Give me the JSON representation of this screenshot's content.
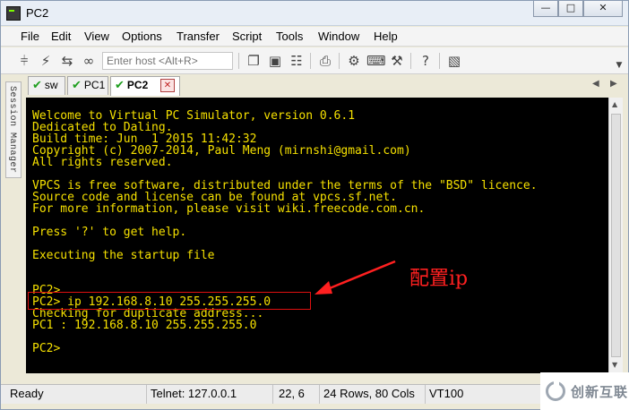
{
  "window": {
    "title": "PC2",
    "controls": [
      "—",
      "□",
      "✕"
    ]
  },
  "menu": [
    "File",
    "Edit",
    "View",
    "Options",
    "Transfer",
    "Script",
    "Tools",
    "Window",
    "Help"
  ],
  "toolbar": {
    "host_placeholder": "Enter host <Alt+R>"
  },
  "tabs": [
    {
      "label": "sw",
      "active": false
    },
    {
      "label": "PC1",
      "active": false
    },
    {
      "label": "PC2",
      "active": true
    }
  ],
  "tab_nav": {
    "prev": "◀",
    "next": "▶"
  },
  "side_panel": {
    "label": "Session Manager"
  },
  "terminal": {
    "lines": [
      "Welcome to Virtual PC Simulator, version 0.6.1",
      "Dedicated to Daling.",
      "Build time: Jun  1 2015 11:42:32",
      "Copyright (c) 2007-2014, Paul Meng (mirnshi@gmail.com)",
      "All rights reserved.",
      "",
      "VPCS is free software, distributed under the terms of the \"BSD\" licence.",
      "Source code and license can be found at vpcs.sf.net.",
      "For more information, please visit wiki.freecode.com.cn.",
      "",
      "Press '?' to get help.",
      "",
      "Executing the startup file",
      "",
      "",
      "PC2>",
      "PC2> ip 192.168.8.10 255.255.255.0",
      "Checking for duplicate address...",
      "PC1 : 192.168.8.10 255.255.255.0",
      "",
      "PC2>"
    ]
  },
  "annotation": {
    "text": "配置ip",
    "color": "#ff2020"
  },
  "statusbar": {
    "ready": "Ready",
    "telnet": "Telnet: 127.0.0.1",
    "position": "22,  6",
    "size": "24 Rows, 80 Cols",
    "emulation": "VT100"
  },
  "watermark": {
    "text": "创新互联"
  },
  "colors": {
    "terminal_bg": "#000000",
    "terminal_fg": "#f5e000",
    "annotation_red": "#ff2020"
  }
}
